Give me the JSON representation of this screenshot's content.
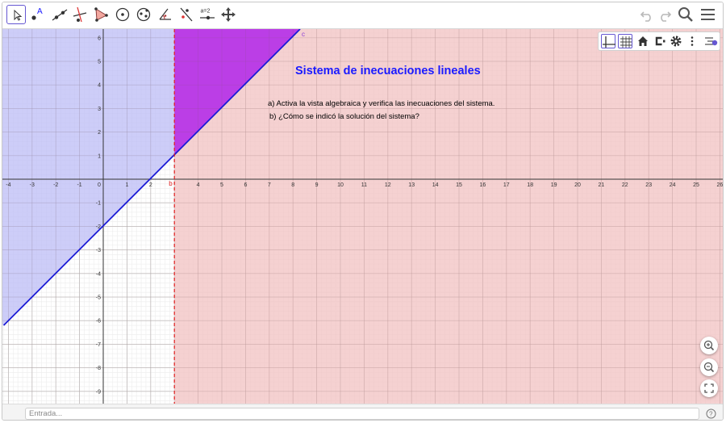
{
  "toolbar": {
    "tools": [
      {
        "id": "move",
        "name": "move-tool-icon",
        "selected": true
      },
      {
        "id": "point",
        "name": "point-tool-icon",
        "label": "A"
      },
      {
        "id": "line",
        "name": "line-tool-icon"
      },
      {
        "id": "perpendicular",
        "name": "perpendicular-line-tool-icon"
      },
      {
        "id": "polygon",
        "name": "polygon-tool-icon"
      },
      {
        "id": "circle",
        "name": "circle-tool-icon"
      },
      {
        "id": "ellipse",
        "name": "ellipse-tool-icon"
      },
      {
        "id": "angle",
        "name": "angle-tool-icon"
      },
      {
        "id": "reflect",
        "name": "reflect-tool-icon"
      },
      {
        "id": "slider",
        "name": "slider-tool-icon",
        "label": "a=2"
      },
      {
        "id": "move-view",
        "name": "move-graphics-view-icon"
      }
    ],
    "right": [
      "undo-icon",
      "redo-icon",
      "search-icon",
      "menu-icon"
    ]
  },
  "style_bar": [
    "axes-toggle-icon",
    "grid-toggle-icon",
    "home-icon",
    "label-style-icon",
    "settings-icon",
    "more-icon",
    "style-bar-toggle-icon"
  ],
  "graphics": {
    "title": "Sistema de inecuaciones lineales",
    "instructions": [
      "a) Activa la vista algebraica y verifica las inecuaciones del sistema.",
      "b) ¿Cómo se indicó la solución del sistema?"
    ],
    "object_labels": {
      "line": "b",
      "vertical": "c"
    },
    "colors": {
      "blue_region": "#bcbcf6",
      "red_region": "#f2c2c2",
      "purple_region": "#bb3ee6",
      "line_color": "#1b1bd6",
      "dashed_line_color": "#e02020",
      "axis_color": "#333333",
      "title_color": "#1a1aff"
    },
    "axes": {
      "x_range": [
        -4.2,
        26.3
      ],
      "y_range": [
        -9.8,
        6.3
      ],
      "x_ticks": [
        "-4",
        "-3",
        "-2",
        "-1",
        "0",
        "1",
        "2",
        "4",
        "5",
        "6",
        "7",
        "8",
        "9",
        "10",
        "11",
        "12",
        "13",
        "14",
        "15",
        "16",
        "17",
        "18",
        "19",
        "20",
        "21",
        "22",
        "23",
        "24",
        "25",
        "26"
      ],
      "y_ticks": [
        "6",
        "5",
        "4",
        "3",
        "2",
        "1",
        "-1",
        "-2",
        "-3",
        "-4",
        "-5",
        "-6",
        "-7",
        "-8",
        "-9"
      ]
    },
    "objects": {
      "line_b": {
        "equation": "y = x - 2"
      },
      "line_c": {
        "equation": "x = 3"
      }
    }
  },
  "zoom": [
    "zoom-in-icon",
    "zoom-out-icon",
    "fullscreen-icon"
  ],
  "input_bar": {
    "placeholder": "Entrada..."
  }
}
